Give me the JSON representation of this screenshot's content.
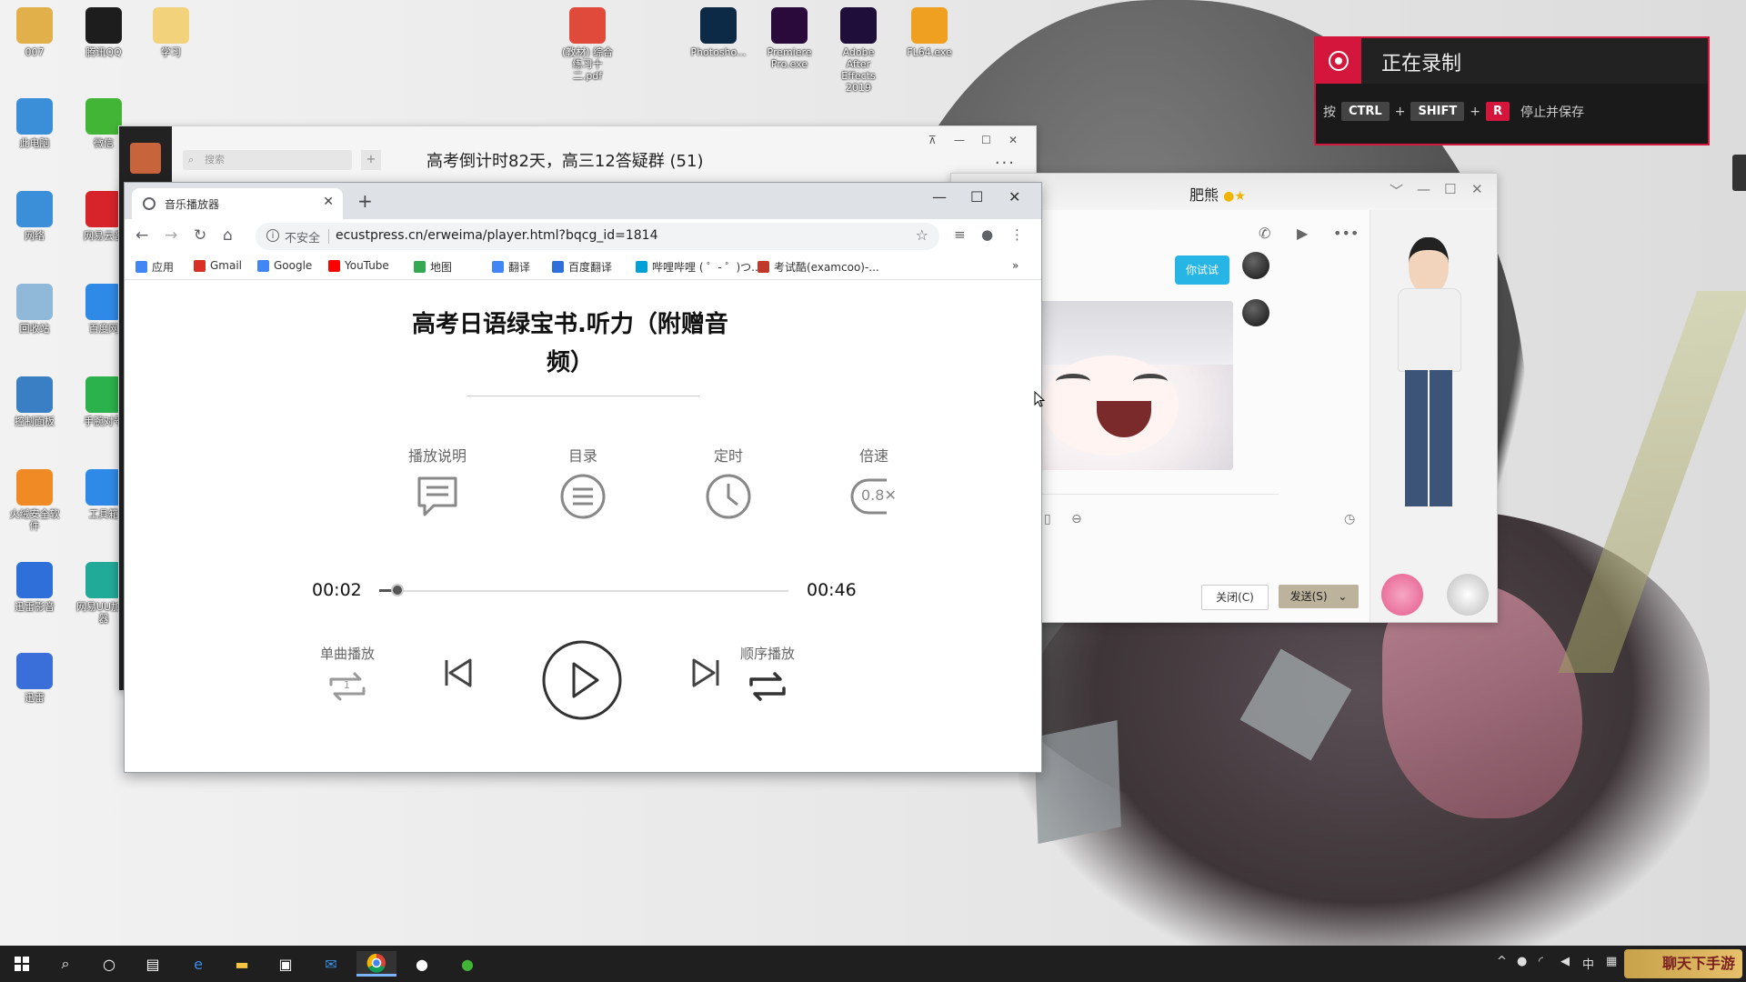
{
  "desktop": {
    "icons": [
      {
        "label": "007",
        "color": "#e2b04a"
      },
      {
        "label": "腾讯QQ",
        "color": "#1d1d1d"
      },
      {
        "label": "学习",
        "color": "#f2d27a"
      },
      {
        "label": "此电脑",
        "color": "#3b8fd9"
      },
      {
        "label": "微信",
        "color": "#42b536"
      },
      {
        "label": "网络",
        "color": "#3b8fd9"
      },
      {
        "label": "网易云音",
        "color": "#d7242b"
      },
      {
        "label": "回收站",
        "color": "#8fb8d9"
      },
      {
        "label": "百度网",
        "color": "#2e8ae6"
      },
      {
        "label": "控制面板",
        "color": "#3a7fc4"
      },
      {
        "label": "手腕对号",
        "color": "#2bb24c"
      },
      {
        "label": "火绒安全软件",
        "color": "#f08a24"
      },
      {
        "label": "工具箱",
        "color": "#2e8ae6"
      },
      {
        "label": "迅雷影音",
        "color": "#2e6fd9"
      },
      {
        "label": "网易UU加速器",
        "color": "#22aa99"
      },
      {
        "label": "迅雷",
        "color": "#3a6fd9"
      },
      {
        "label": "(教材) 综合练习十二.pdf",
        "color": "#e04a3a"
      },
      {
        "label": "Photosho...",
        "color": "#0c2a45"
      },
      {
        "label": "Premiere Pro.exe",
        "color": "#2a0a3a"
      },
      {
        "label": "Adobe After Effects 2019",
        "color": "#1f0d3a"
      },
      {
        "label": "FL64.exe",
        "color": "#f0a020"
      }
    ]
  },
  "qq_group": {
    "search_placeholder": "搜索",
    "plus": "+",
    "title": "高考倒计时82天，高三12答疑群 (51)",
    "pin": "⊼",
    "min": "—",
    "max": "☐",
    "close": "✕",
    "more": "···"
  },
  "recording": {
    "title": "正在录制",
    "press": "按",
    "keys": [
      "CTRL",
      "SHIFT",
      "R"
    ],
    "plus": "+",
    "action": "停止并保存"
  },
  "chrome": {
    "tab_title": "音乐播放器",
    "tab_close": "✕",
    "new_tab": "+",
    "win": {
      "min": "—",
      "max": "☐",
      "close": "✕"
    },
    "nav": {
      "back": "←",
      "forward": "→",
      "reload": "↻",
      "home": "⌂"
    },
    "insecure_label": "不安全",
    "url": "ecustpress.cn/erweima/player.html?bqcg_id=1814",
    "bookmarks": [
      {
        "label": "应用",
        "color": "#4285f4"
      },
      {
        "label": "Gmail",
        "color": "#d93025"
      },
      {
        "label": "Google",
        "color": "#4285f4"
      },
      {
        "label": "YouTube",
        "color": "#ff0000"
      },
      {
        "label": "地图",
        "color": "#34a853"
      },
      {
        "label": "翻译",
        "color": "#4285f4"
      },
      {
        "label": "百度翻译",
        "color": "#2e6fd9"
      },
      {
        "label": "哔哩哔哩 ( ゜- ゜)つ...",
        "color": "#00a1d6"
      },
      {
        "label": "考试酷(examcoo)-...",
        "color": "#c0392b"
      }
    ],
    "bookmarks_more": "»"
  },
  "player": {
    "title": "高考日语绿宝书.听力（附赠音频）",
    "options": {
      "instructions": "播放说明",
      "catalog": "目录",
      "timer": "定时",
      "speed_label": "倍速",
      "speed_value": "0.8✕"
    },
    "current_time": "00:02",
    "total_time": "00:46",
    "progress_fraction": 0.045,
    "single_play": "单曲播放",
    "single_badge": "1",
    "sequential_play": "顺序播放"
  },
  "qq_chat": {
    "name": "肥熊",
    "bubble": "你试试",
    "close_btn": "关闭(C)",
    "send_btn": "发送(S)",
    "win": {
      "menu": "﹀",
      "min": "—",
      "max": "☐",
      "close": "✕"
    }
  },
  "taskbar": {
    "tray_ime": "中"
  },
  "watermark": "聊天下手游"
}
